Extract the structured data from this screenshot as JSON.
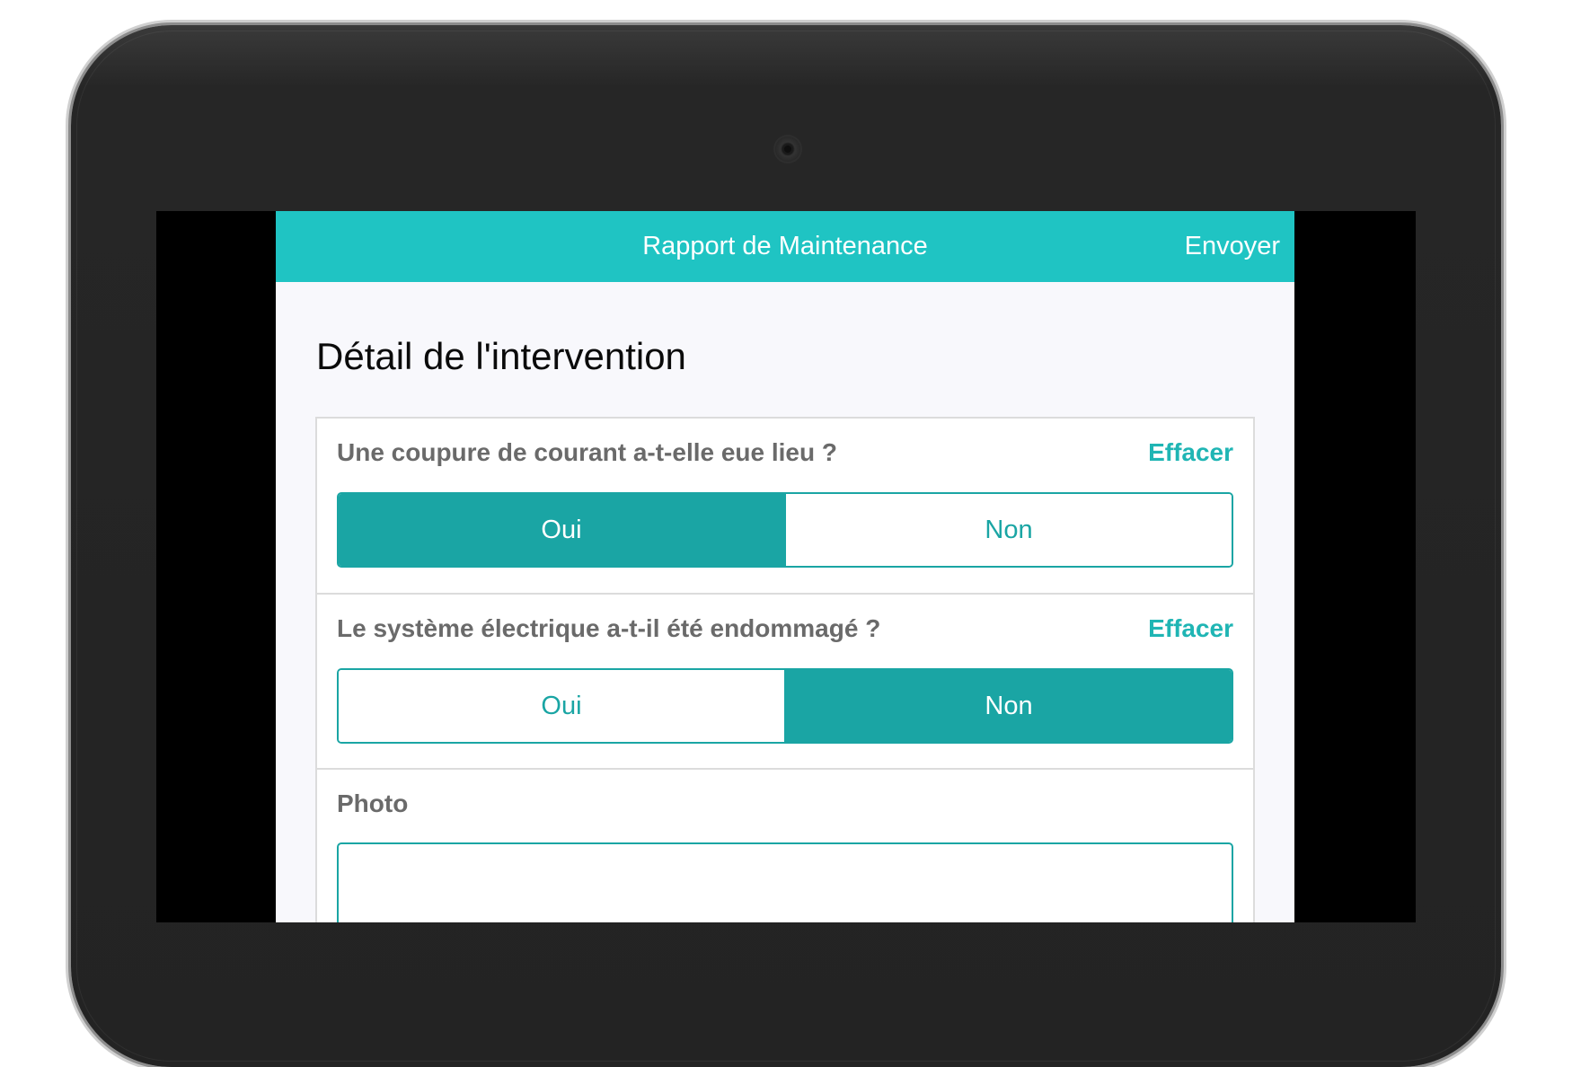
{
  "header": {
    "title": "Rapport de Maintenance",
    "send_label": "Envoyer"
  },
  "page": {
    "section_title": "Détail de l'intervention"
  },
  "form": {
    "fields": [
      {
        "question": "Une coupure de courant a-t-elle eue lieu ?",
        "clear_label": "Effacer",
        "options": [
          "Oui",
          "Non"
        ],
        "selected": "Oui"
      },
      {
        "question": "Le système électrique a-t-il été endommagé ?",
        "clear_label": "Effacer",
        "options": [
          "Oui",
          "Non"
        ],
        "selected": "Non"
      },
      {
        "label": "Photo"
      }
    ]
  },
  "colors": {
    "navbar": "#1fc4c3",
    "accent": "#1aa5a4",
    "background": "#f8f8fc"
  }
}
